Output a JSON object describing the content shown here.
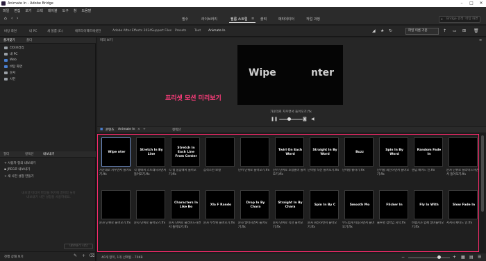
{
  "window": {
    "title": "Animate In - Adobe Bridge",
    "controls": [
      "–",
      "□",
      "✕"
    ]
  },
  "menu": [
    "파일",
    "편집",
    "보기",
    "스택",
    "레이블",
    "도구",
    "창",
    "도움말"
  ],
  "workspaces": [
    {
      "label": "필수",
      "active": false
    },
    {
      "label": "라이브러리",
      "active": false
    },
    {
      "label": "필름 스트립",
      "active": true
    },
    {
      "label": "메타데이터",
      "active": false
    },
    {
      "label": "작업 과정",
      "active": false
    }
  ],
  "workspace_menu_icon": "≡",
  "workspace_output": "출력",
  "search_placeholder": "Bridge 검색: 바탕 화면",
  "path": [
    "바탕 화면",
    "내 PC",
    "새 볼륨 (E:)",
    "애프터이펙트애셋전",
    "Adobe After Effects 2024",
    "Support Files",
    "Presets",
    "Text",
    "Animate In"
  ],
  "sort_label": "파일 이름 기준",
  "left": {
    "tabs": [
      "즐겨찾기",
      "폴더"
    ],
    "favorites": [
      {
        "label": "라이브러리",
        "color": "#9aa0a6"
      },
      {
        "label": "내 PC",
        "color": "#9aa0a6"
      },
      {
        "label": "Web",
        "color": "#4a7fd1"
      },
      {
        "label": "바탕 화면",
        "color": "#4a7fd1"
      },
      {
        "label": "문서",
        "color": "#9aa0a6"
      },
      {
        "label": "사진",
        "color": "#9aa0a6"
      }
    ],
    "bottom_tabs": [
      "필터",
      "컬렉션",
      "내보내기"
    ],
    "export_items": [
      "사용자 정의 내보내기",
      "JPEG로 내보내기",
      "새 사전 설정 만들기"
    ],
    "empty_text": "내보낼 미디어 파일을 여기에 끌어다 놓아 내보내기 사전 설정을 사용하세요.",
    "export_button": "내보내기 시작",
    "footer": "진행 상태 보기"
  },
  "preview": {
    "tab": "미리 보기",
    "stage_left": "Wipe",
    "stage_right": "nter",
    "overlay": "프리셋 모션 미리보기",
    "filename": "가운데로 지우면서 들어오기.ffx"
  },
  "content": {
    "tabs": [
      "콘텐츠",
      "Animate In",
      "컬렉션"
    ],
    "cells": [
      {
        "thumb": "Wipe     nter",
        "caption": "가운데로 지우면서 들어오기.ffx",
        "selected": true
      },
      {
        "thumb": "Stretch In By Line",
        "caption": "각 행에서 스트레치하면서 들어오기.ffx"
      },
      {
        "thumb": "Stretch In Each Line From Center",
        "caption": "각 행 중심에서 들어오기.ffx"
      },
      {
        "thumb": "",
        "caption": "갑작스런 보컬"
      },
      {
        "thumb": "",
        "caption": "단어 단위로 들어오기.ffx"
      },
      {
        "thumb": "Twirl On Each Word",
        "caption": "단어 단위로 소용돌이 들어오기.ffx"
      },
      {
        "thumb": "Straight In By Word",
        "caption": "단어별 직선 들어오기.ffx"
      },
      {
        "thumb": "Buzz",
        "caption": "단어별 윙하기.ffx"
      },
      {
        "thumb": "Spin In By Word",
        "caption": "단어별 회전하면서 들어오기.ffx"
      },
      {
        "thumb": "Random Fade In",
        "caption": "랜덤 페이드 인.ffx"
      },
      {
        "thumb": "",
        "caption": "문자 단위로 슬라이드하면서 들어오기.ffx"
      },
      {
        "thumb": "",
        "caption": "문자 단위로 들어오기.ffx"
      },
      {
        "thumb": "",
        "caption": "문자 단위로 들어오기.ffx"
      },
      {
        "thumb": "Characters In Like Bo",
        "caption": "문자 단위로 슬라이드하면서 들어오기.ffx"
      },
      {
        "thumb": "Xla F Rando",
        "caption": "문자 무작위 들어오기.ffx"
      },
      {
        "thumb": "Drop In By Chara",
        "caption": "문자 떨어지면서 들어오기.ffx"
      },
      {
        "thumb": "Straight In By Chara",
        "caption": "문자 단위로 직선 들어오기.ffx"
      },
      {
        "thumb": "Spin In By C",
        "caption": "문자 회전하면서 들어오기.ffx"
      },
      {
        "thumb": "Smooth Mo",
        "caption": "부드럽게 이동하면서 들어오기.ffx"
      },
      {
        "thumb": "Flicker In",
        "caption": "불투명 깜박임 시작.ffx"
      },
      {
        "thumb": "Fly In With",
        "caption": "비행기가 함께 날아들어오기.ffx"
      },
      {
        "thumb": "Slow Fade In",
        "caption": "서서히 페이드 인.ffx"
      }
    ]
  },
  "status": {
    "text": "40개 항목, 1개 선택됨 - 70KB"
  }
}
